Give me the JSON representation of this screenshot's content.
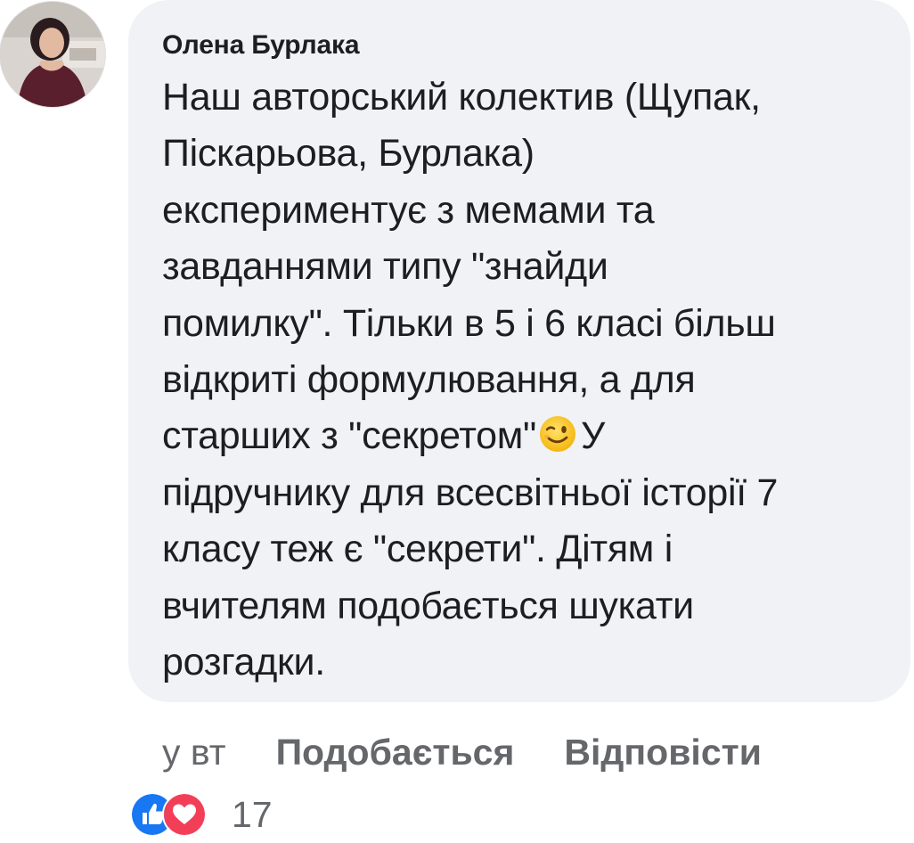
{
  "comment": {
    "author": "Олена Бурлака",
    "text_lines": [
      "Наш авторський колектив (Щупак,",
      "Піскарьова, Бурлака)",
      "експериментує з мемами та",
      "завданнями типу \"знайди",
      "помилку\". Тільки в 5 і 6 класі більш",
      "відкриті формулювання, а для",
      "старших з \"секретом\"",
      "підручнику для всесвітньої історії 7",
      "класу теж є \"секрети\". Дітям і",
      "вчителям подобається шукати",
      "розгадки."
    ],
    "line7_after_emoji": "У",
    "emoji": "wink-face"
  },
  "actions": {
    "time": "у вт",
    "like_label": "Подобається",
    "reply_label": "Відповісти"
  },
  "reactions": {
    "types": [
      "like",
      "love"
    ],
    "count": "17"
  },
  "colors": {
    "bubble": "#f0f2f5",
    "text": "#1c1e21",
    "secondary_text": "#65676b",
    "like_blue": "#1877f2",
    "love_red": "#f33e58"
  }
}
